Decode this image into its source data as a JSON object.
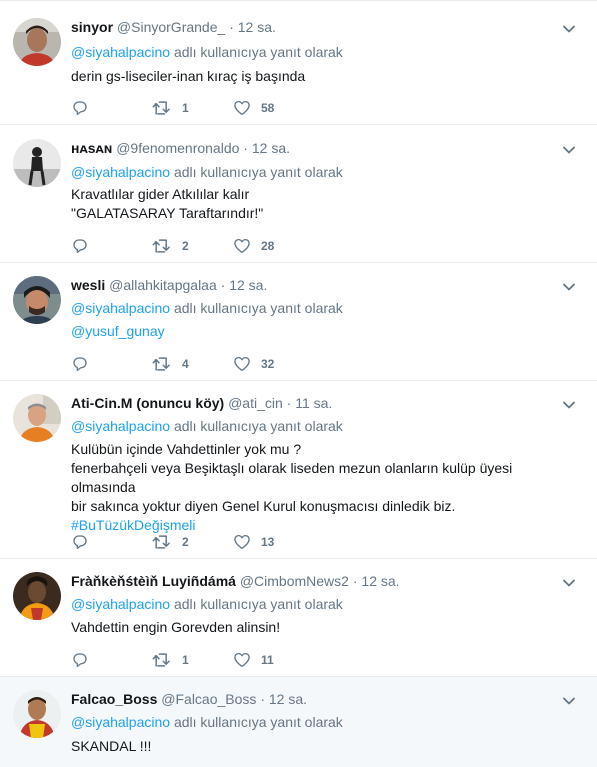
{
  "reply_prefix": "adlı kullanıcıya yanıt olarak",
  "tweets": [
    {
      "name": "sinyor",
      "handle": "@SinyorGrande_",
      "dot": "·",
      "time": "12 sa.",
      "reply_to": "@siyahalpacino",
      "lines": [
        "derin gs-liseciler-inan kıraç iş başında"
      ],
      "retweets": "1",
      "likes": "58"
    },
    {
      "name": "ʜᴀsᴀɴ",
      "handle": "@9fenomenronaldo",
      "dot": "·",
      "time": "12 sa.",
      "reply_to": "@siyahalpacino",
      "lines": [
        "Kravatlılar gider Atkılılar kalır",
        "\"GALATASARAY Taraftarındır!\""
      ],
      "retweets": "2",
      "likes": "28"
    },
    {
      "name": "wesli",
      "handle": "@allahkitapgalaa",
      "dot": "·",
      "time": "12 sa.",
      "reply_to": "@siyahalpacino",
      "link": "@yusuf_gunay",
      "retweets": "4",
      "likes": "32"
    },
    {
      "name": "Ati-Cin.M (onuncu köy)",
      "handle": "@ati_cin",
      "dot": "·",
      "time": "11 sa.",
      "reply_to": "@siyahalpacino",
      "lines": [
        "Kulübün içinde Vahdettinler yok mu ?",
        "fenerbahçeli veya Beşiktaşlı olarak liseden mezun olanların kulüp üyesi olmasında",
        "bir sakınca yoktur diyen Genel Kurul konuşmacısı dinledik biz."
      ],
      "hashtag": "#BuTüzükDeğişmeli",
      "retweets": "2",
      "likes": "13"
    },
    {
      "name": "Fràňkèňśtèìň Luyiñdámá",
      "handle": "@CimbomNews2",
      "dot": "·",
      "time": "12 sa.",
      "reply_to": "@siyahalpacino",
      "lines": [
        "Vahdettin engin Gorevden alinsin!"
      ],
      "retweets": "1",
      "likes": "11"
    },
    {
      "name": "Falcao_Boss",
      "handle": "@Falcao_Boss",
      "dot": "·",
      "time": "12 sa.",
      "reply_to": "@siyahalpacino",
      "lines": [
        "SKANDAL !!!"
      ]
    }
  ],
  "colors": {
    "accent": "#1da1f2",
    "muted": "#657786",
    "text": "#14171a",
    "border": "#e6ecf0",
    "highlight_bg": "#f5f8fa"
  },
  "icons": {
    "reply": "reply-icon",
    "retweet": "retweet-icon",
    "like": "heart-icon",
    "caret": "chevron-down-icon"
  }
}
